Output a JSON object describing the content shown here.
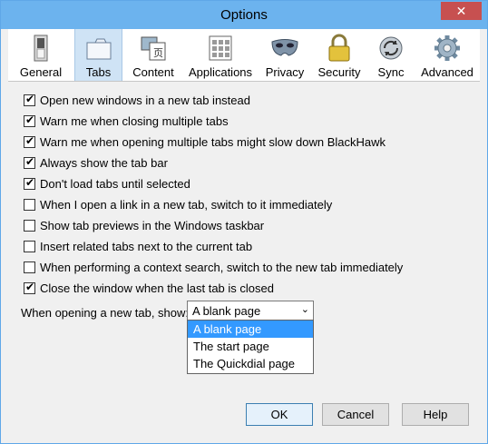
{
  "window": {
    "title": "Options",
    "close_glyph": "✕"
  },
  "toolbar": {
    "tabs": [
      {
        "label": "General",
        "icon": "switch-icon"
      },
      {
        "label": "Tabs",
        "icon": "tabs-icon",
        "selected": true
      },
      {
        "label": "Content",
        "icon": "content-icon"
      },
      {
        "label": "Applications",
        "icon": "applications-icon"
      },
      {
        "label": "Privacy",
        "icon": "mask-icon"
      },
      {
        "label": "Security",
        "icon": "lock-icon"
      },
      {
        "label": "Sync",
        "icon": "sync-icon"
      },
      {
        "label": "Advanced",
        "icon": "gear-icon"
      }
    ]
  },
  "options": [
    {
      "label": "Open new windows in a new tab instead",
      "checked": true
    },
    {
      "label": "Warn me when closing multiple tabs",
      "checked": true
    },
    {
      "label": "Warn me when opening multiple tabs might slow down BlackHawk",
      "checked": true
    },
    {
      "label": "Always show the tab bar",
      "checked": true
    },
    {
      "label": "Don't load tabs until selected",
      "checked": true
    },
    {
      "label": "When I open a link in a new tab, switch to it immediately",
      "checked": false
    },
    {
      "label": "Show tab previews in the Windows taskbar",
      "checked": false
    },
    {
      "label": "Insert related tabs next to the current tab",
      "checked": false
    },
    {
      "label": "When performing a context search, switch to the new tab immediately",
      "checked": false
    },
    {
      "label": "Close the window when the last tab is closed",
      "checked": true
    }
  ],
  "new_tab": {
    "label": "When opening a new tab, show:",
    "selected": "A blank page",
    "options": [
      "A blank page",
      "The start page",
      "The Quickdial page"
    ]
  },
  "buttons": {
    "ok": "OK",
    "cancel": "Cancel",
    "help": "Help"
  },
  "check_glyph": "✔",
  "arrow_glyph": "⌄",
  "colors": {
    "title_bar": "#6cb3ee",
    "close": "#c75050",
    "selection": "#3399ff"
  }
}
